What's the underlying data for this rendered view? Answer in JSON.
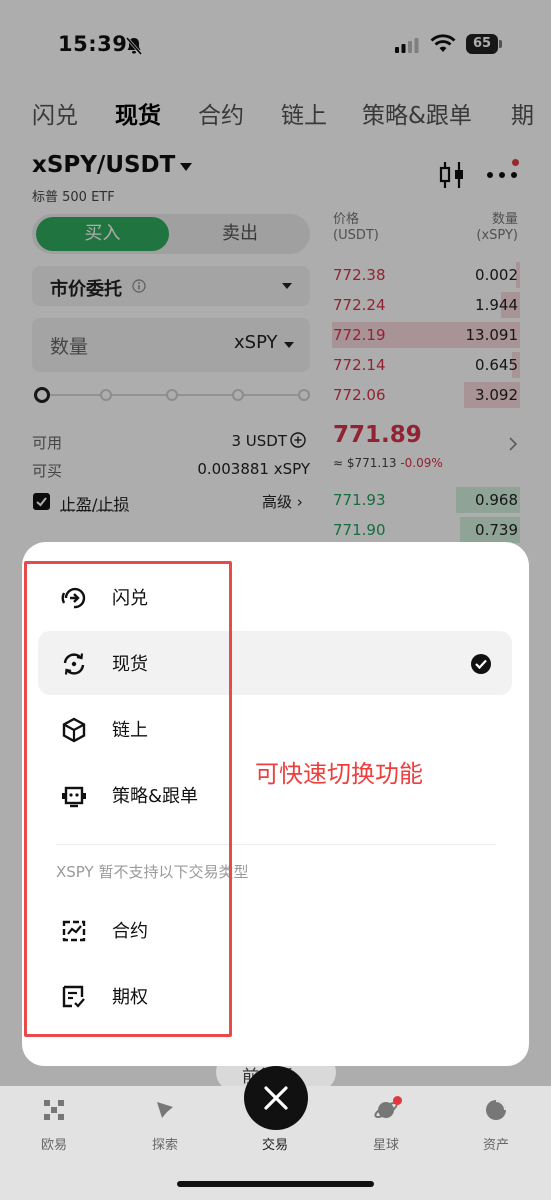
{
  "status_bar": {
    "time": "15:39",
    "battery": "65"
  },
  "top_tabs": [
    "闪兑",
    "现货",
    "合约",
    "链上",
    "策略&跟单",
    "期"
  ],
  "pair": {
    "symbol": "xSPY/USDT",
    "subtitle": "标普 500 ETF"
  },
  "trade": {
    "buy_label": "买入",
    "sell_label": "卖出",
    "order_type": "市价委托",
    "qty_label": "数量",
    "qty_unit": "xSPY",
    "slider_percent": 0,
    "available_label": "可用",
    "available_value": "3 USDT",
    "buyable_label": "可买",
    "buyable_value": "0.003881 xSPY",
    "tp_sl_label": "止盈/止损",
    "advanced_label": "高级 ›"
  },
  "orderbook": {
    "price_header": "价格",
    "price_unit": "(USDT)",
    "qty_header": "数量",
    "qty_unit": "(xSPY)",
    "asks": [
      {
        "price": "772.38",
        "qty": "0.002",
        "depth": 0.02
      },
      {
        "price": "772.24",
        "qty": "1.944",
        "depth": 0.1
      },
      {
        "price": "772.19",
        "qty": "13.091",
        "depth": 1.0
      },
      {
        "price": "772.14",
        "qty": "0.645",
        "depth": 0.04
      },
      {
        "price": "772.06",
        "qty": "3.092",
        "depth": 0.3
      }
    ],
    "last_price": "771.89",
    "last_usd": "≈ $771.13",
    "last_change": "-0.09%",
    "bids": [
      {
        "price": "771.93",
        "qty": "0.968",
        "depth": 0.34
      },
      {
        "price": "771.90",
        "qty": "0.739",
        "depth": 0.32
      }
    ]
  },
  "sheet": {
    "supported": [
      {
        "label": "闪兑",
        "icon": "flash-swap-icon",
        "selected": false
      },
      {
        "label": "现货",
        "icon": "spot-cycle-icon",
        "selected": true
      },
      {
        "label": "链上",
        "icon": "cube-icon",
        "selected": false
      },
      {
        "label": "策略&跟单",
        "icon": "robot-icon",
        "selected": false
      }
    ],
    "unsupported_note": "XSPY 暂不支持以下交易类型",
    "unsupported": [
      {
        "label": "合约",
        "icon": "contract-icon"
      },
      {
        "label": "期权",
        "icon": "option-icon"
      }
    ],
    "annotation": "可快速切换功能"
  },
  "behind_button": "前往币",
  "bottom_nav": [
    {
      "label": "欧易",
      "icon": "okx-logo-icon"
    },
    {
      "label": "探索",
      "icon": "compass-icon"
    },
    {
      "label": "交易",
      "icon": "close-icon"
    },
    {
      "label": "星球",
      "icon": "planet-icon"
    },
    {
      "label": "资产",
      "icon": "pie-chart-icon"
    }
  ],
  "colors": {
    "buy": "#2eac5d",
    "sell": "#d6344a",
    "annotation": "#ee3f3f"
  }
}
